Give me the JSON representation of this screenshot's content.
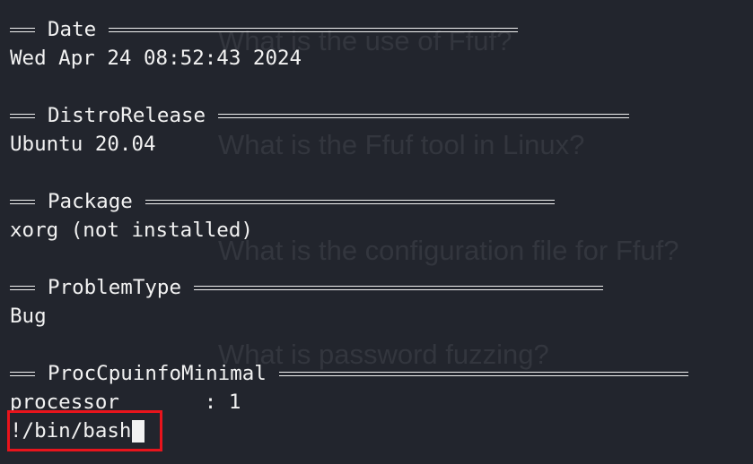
{
  "watermarks": [
    "What is the use of Ffuf?",
    "What is the Ffuf tool in Linux?",
    "What is the configuration file for Ffuf?",
    "What is password fuzzing?"
  ],
  "sections": [
    {
      "header": "Date",
      "value": "Wed Apr 24 08:52:43 2024"
    },
    {
      "header": "DistroRelease",
      "value": "Ubuntu 20.04"
    },
    {
      "header": "Package",
      "value": "xorg (not installed)"
    },
    {
      "header": "ProblemType",
      "value": "Bug"
    },
    {
      "header": "ProcCpuinfoMinimal",
      "value": "processor       : 1"
    }
  ],
  "prompt": {
    "input": "!/bin/bash"
  },
  "colors": {
    "background": "#22252d",
    "text": "#f2f2f2",
    "highlight_border": "#e8141c"
  }
}
